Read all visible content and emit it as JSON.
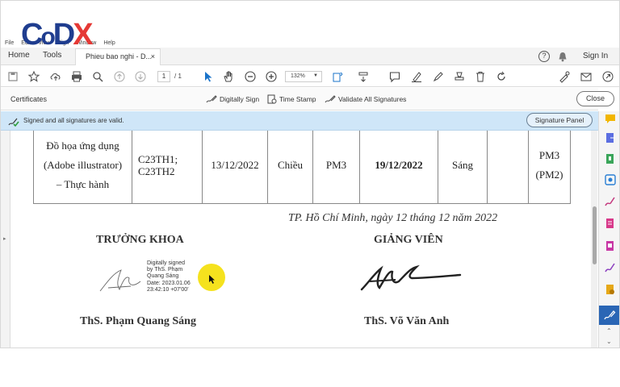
{
  "logo": {
    "c": "C",
    "o": "o",
    "d": "D",
    "x": "X"
  },
  "menu": [
    "File",
    "Edit",
    "View",
    "Sign",
    "Window",
    "Help"
  ],
  "tabs": {
    "home": "Home",
    "tools": "Tools",
    "document": "Phieu bao nghi - D...",
    "close": "×"
  },
  "header": {
    "help": "?",
    "sign_in": "Sign In"
  },
  "toolbar": {
    "page_current": "1",
    "page_total": "/ 1",
    "zoom": "132%"
  },
  "certificates": {
    "label": "Certificates",
    "digitally_sign": "Digitally Sign",
    "time_stamp": "Time Stamp",
    "validate_all": "Validate All Signatures",
    "close": "Close"
  },
  "signature_bar": {
    "message": "Signed and all signatures are valid.",
    "panel_button": "Signature Panel"
  },
  "table_row": {
    "subject_line1": "Đồ họa ứng dụng",
    "subject_line2": "(Adobe illustrator)",
    "subject_line3": "– Thực hành",
    "classes_line1": "C23TH1;",
    "classes_line2": "C23TH2",
    "date": "13/12/2022",
    "session": "Chiều",
    "room": "PM3",
    "makeup_date": "19/12/2022",
    "makeup_session": "Sáng",
    "empty": "",
    "makeup_room_line1": "PM3",
    "makeup_room_line2": "(PM2)"
  },
  "signature_block": {
    "place_date": "TP. Hồ Chí Minh, ngày 12 tháng 12 năm 2022",
    "left_title": "TRƯỞNG KHOA",
    "right_title": "GIẢNG VIÊN",
    "digital_sig": [
      "Digitally signed",
      "by ThS. Phạm",
      "Quang Sáng",
      "Date: 2023.01.06",
      "23:42:10 +07'00'"
    ],
    "left_name": "ThS. Phạm Quang Sáng",
    "right_name": "ThS. Võ Văn Anh"
  },
  "colors": {
    "logo_blue": "#1f3d8f",
    "logo_red": "#e53935",
    "sig_bar": "#cfe6f8",
    "cursor_highlight": "#f5e21e",
    "tool_blue": "#1a73c9"
  }
}
